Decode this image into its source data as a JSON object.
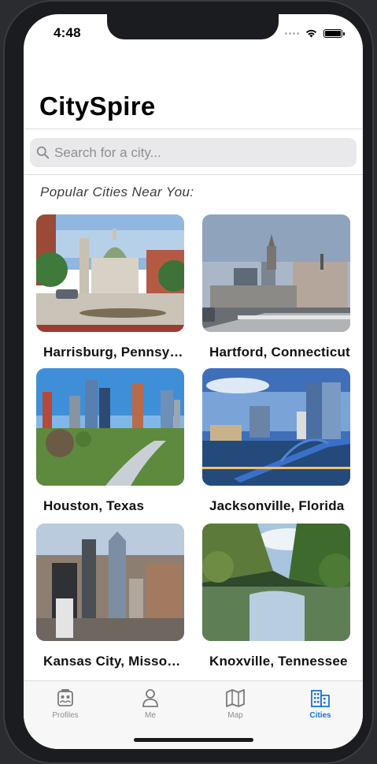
{
  "status_bar": {
    "time": "4:48"
  },
  "header": {
    "title": "CitySpire"
  },
  "search": {
    "placeholder": "Search for a city...",
    "value": ""
  },
  "section": {
    "title": "Popular Cities Near You:"
  },
  "cities": [
    {
      "name": "Harrisburg, Pennsyl..."
    },
    {
      "name": "Hartford, Connecticut"
    },
    {
      "name": "Houston, Texas"
    },
    {
      "name": "Jacksonville, Florida"
    },
    {
      "name": "Kansas City, Missouri"
    },
    {
      "name": "Knoxville, Tennessee"
    }
  ],
  "tabs": [
    {
      "label": "Profiles",
      "icon": "profiles-icon"
    },
    {
      "label": "Me",
      "icon": "person-icon"
    },
    {
      "label": "Map",
      "icon": "map-icon"
    },
    {
      "label": "Cities",
      "icon": "buildings-icon"
    }
  ],
  "colors": {
    "accent": "#1a73d9",
    "inactive": "#8e8e93"
  }
}
